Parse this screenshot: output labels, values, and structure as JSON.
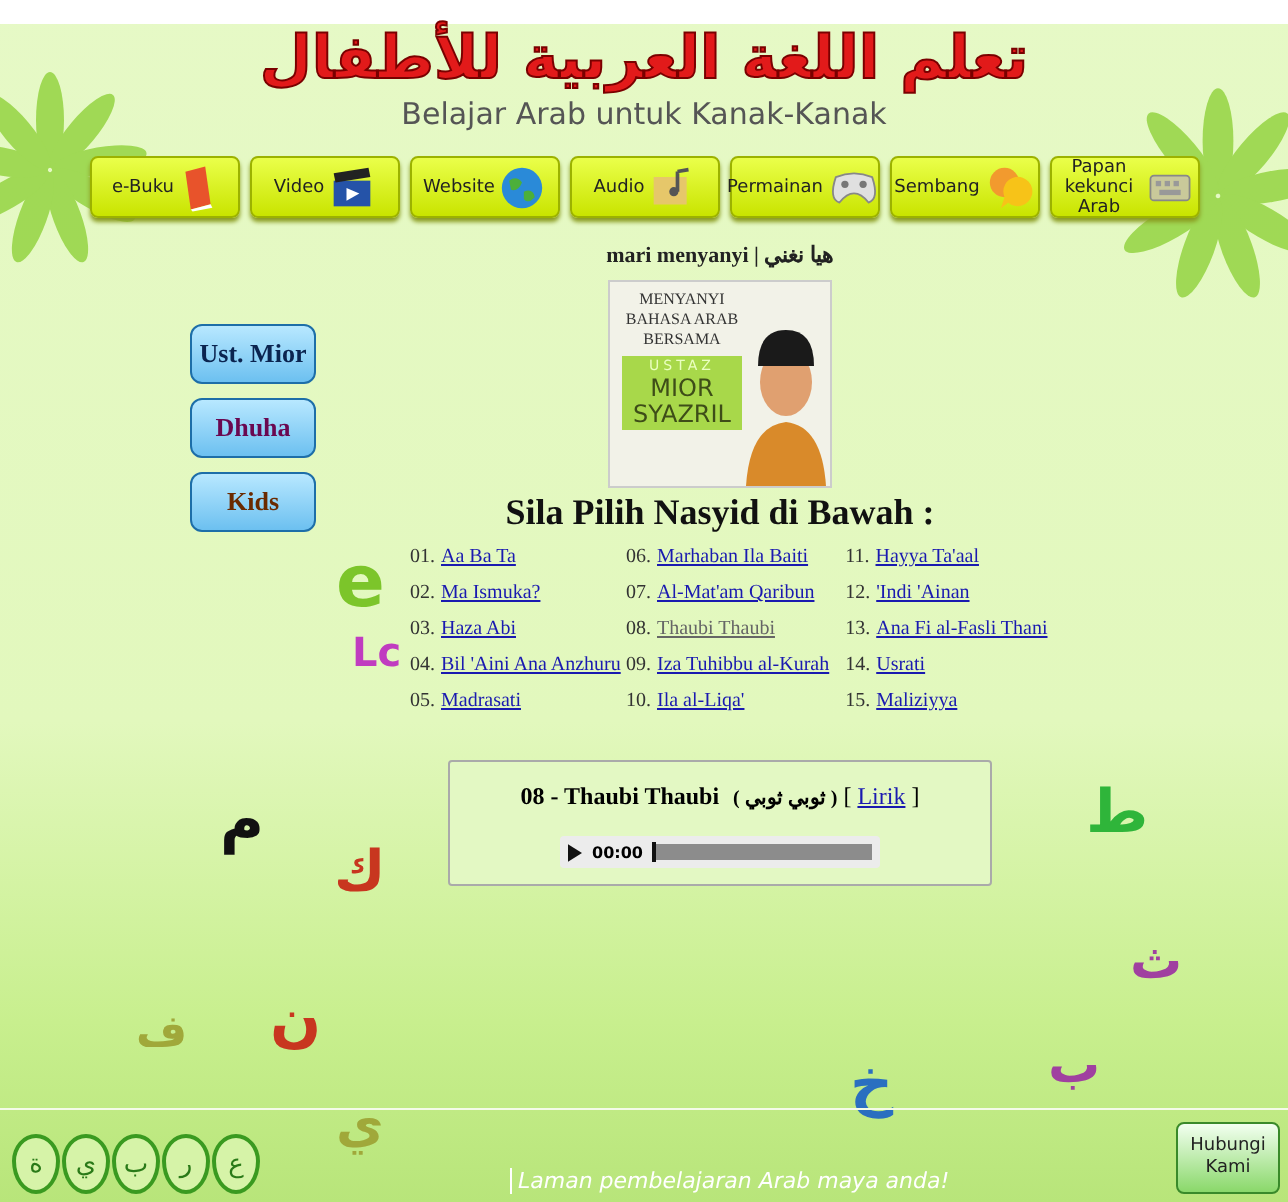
{
  "header": {
    "title": "تعلم اللغة العربية للأطفال",
    "subtitle": "Belajar Arab untuk Kanak-Kanak"
  },
  "nav": [
    {
      "label": "e-Buku"
    },
    {
      "label": "Video"
    },
    {
      "label": "Website"
    },
    {
      "label": "Audio"
    },
    {
      "label": "Permainan"
    },
    {
      "label": "Sembang"
    },
    {
      "label": "Papan kekunci Arab"
    }
  ],
  "side_buttons": [
    "Ust. Mior",
    "Dhuha",
    "Kids"
  ],
  "breadcrumb": {
    "latin": "mari menyanyi",
    "separator": "|",
    "arabic": "هيا نغني"
  },
  "banner": {
    "line1": "MENYANYI",
    "line2": "BAHASA ARAB",
    "line3": "BERSAMA",
    "ustaz": "USTAZ",
    "name1": "MIOR",
    "name2": "SYAZRIL"
  },
  "heading": "Sila Pilih Nasyid di Bawah :",
  "songs": [
    {
      "number": "01.",
      "title": "Aa Ba Ta",
      "selected": false
    },
    {
      "number": "02.",
      "title": "Ma Ismuka?",
      "selected": false
    },
    {
      "number": "03.",
      "title": "Haza Abi",
      "selected": false
    },
    {
      "number": "04.",
      "title": "Bil 'Aini Ana Anzhuru",
      "selected": false
    },
    {
      "number": "05.",
      "title": "Madrasati",
      "selected": false
    },
    {
      "number": "06.",
      "title": "Marhaban Ila Baiti",
      "selected": false
    },
    {
      "number": "07.",
      "title": "Al-Mat'am Qaribun",
      "selected": false
    },
    {
      "number": "08.",
      "title": "Thaubi Thaubi",
      "selected": true
    },
    {
      "number": "09.",
      "title": "Iza Tuhibbu al-Kurah",
      "selected": false
    },
    {
      "number": "10.",
      "title": "Ila al-Liqa'",
      "selected": false
    },
    {
      "number": "11.",
      "title": "Hayya Ta'aal",
      "selected": false
    },
    {
      "number": "12.",
      "title": "'Indi 'Ainan",
      "selected": false
    },
    {
      "number": "13.",
      "title": "Ana Fi al-Fasli Thani",
      "selected": false
    },
    {
      "number": "14.",
      "title": "Usrati",
      "selected": false
    },
    {
      "number": "15.",
      "title": "Maliziyya",
      "selected": false
    }
  ],
  "player": {
    "track": "08 - Thaubi Thaubi",
    "arabic": "( ثوبي ثوبي )",
    "lyrics_open": "[",
    "lyrics": "Lirik",
    "lyrics_close": "]",
    "time": "00:00",
    "level": 0
  },
  "letters": [
    {
      "char": "e",
      "color": "#7cc52a"
    },
    {
      "char": "Lc",
      "color": "#c03cc0"
    },
    {
      "char": "م",
      "color": "#111111"
    },
    {
      "char": "ك",
      "color": "#c8361f"
    },
    {
      "char": "ن",
      "color": "#c8361f"
    },
    {
      "char": "ف",
      "color": "#a0a83a"
    },
    {
      "char": "ي",
      "color": "#a0a83a"
    },
    {
      "char": "ط",
      "color": "#2fb53a"
    },
    {
      "char": "ث",
      "color": "#a040a0"
    },
    {
      "char": "خ",
      "color": "#2a6fc0"
    },
    {
      "char": "ب",
      "color": "#a040a0"
    }
  ],
  "footer": {
    "bubbles": [
      "ع",
      "ر",
      "ب",
      "ي",
      "ة"
    ],
    "tagline": "Laman pembelajaran Arab maya anda!",
    "contact": "Hubungi Kami"
  }
}
